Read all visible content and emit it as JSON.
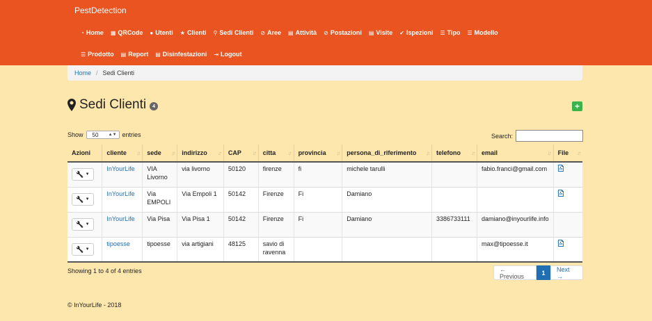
{
  "brand": "PestDetection",
  "nav": {
    "row1": [
      {
        "icon": "dashboard-icon",
        "glyph": "◔",
        "label": "Home"
      },
      {
        "icon": "qrcode-icon",
        "glyph": "▦",
        "label": "QRCode"
      },
      {
        "icon": "user-icon",
        "glyph": "●",
        "label": "Utenti"
      },
      {
        "icon": "star-icon",
        "glyph": "★",
        "label": "Clienti"
      },
      {
        "icon": "map-marker-icon",
        "glyph": "⚲",
        "label": "Sedi Clienti"
      },
      {
        "icon": "ban-icon",
        "glyph": "⊘",
        "label": "Aree"
      },
      {
        "icon": "calendar-icon",
        "glyph": "▤",
        "label": "Attività"
      },
      {
        "icon": "ban-icon",
        "glyph": "⊘",
        "label": "Postazioni"
      },
      {
        "icon": "calendar-icon",
        "glyph": "▤",
        "label": "Visite"
      },
      {
        "icon": "check-icon",
        "glyph": "✔",
        "label": "Ispezioni"
      },
      {
        "icon": "list-icon",
        "glyph": "☰",
        "label": "Tipo"
      },
      {
        "icon": "list-icon",
        "glyph": "☰",
        "label": "Modello"
      }
    ],
    "row2": [
      {
        "icon": "list-icon",
        "glyph": "☰",
        "label": "Prodotto"
      },
      {
        "icon": "calendar-icon",
        "glyph": "▤",
        "label": "Report"
      },
      {
        "icon": "calendar-icon",
        "glyph": "▤",
        "label": "Disinfestazioni"
      },
      {
        "icon": "logout-icon",
        "glyph": "⇥",
        "label": "Logout"
      }
    ]
  },
  "breadcrumb": {
    "home": "Home",
    "current": "Sedi Clienti"
  },
  "page": {
    "title": "Sedi Clienti",
    "count": "4",
    "add": "+"
  },
  "length": {
    "show": "Show",
    "value": "50",
    "entries": "entries"
  },
  "search": {
    "label": "Search:",
    "value": ""
  },
  "table": {
    "headers": [
      "Azioni",
      "cliente",
      "sede",
      "indirizzo",
      "CAP",
      "citta",
      "provincia",
      "persona_di_riferimento",
      "telefono",
      "email",
      "File"
    ],
    "rows": [
      {
        "cliente": "InYourLife",
        "sede": "VIA Livorno",
        "indirizzo": "via livorno",
        "cap": "50120",
        "citta": "firenze",
        "provincia": "fi",
        "persona": "michele tarulli",
        "telefono": "",
        "email": "fabio.franci@gmail.com",
        "file": true
      },
      {
        "cliente": "InYourLife",
        "sede": "Via EMPOLI",
        "indirizzo": "Via Empoli 1",
        "cap": "50142",
        "citta": "Firenze",
        "provincia": "Fi",
        "persona": "Damiano",
        "telefono": "",
        "email": "",
        "file": true
      },
      {
        "cliente": "InYourLife",
        "sede": "Via Pisa",
        "indirizzo": "Via Pisa 1",
        "cap": "50142",
        "citta": "Firenze",
        "provincia": "Fi",
        "persona": "Damiano",
        "telefono": "3386733111",
        "email": "damiano@inyourlife.info",
        "file": false
      },
      {
        "cliente": "tipoesse",
        "sede": "tipoesse",
        "indirizzo": "via artigiani",
        "cap": "48125",
        "citta": "savio di ravenna",
        "provincia": "",
        "persona": "",
        "telefono": "",
        "email": "max@tipoesse.it",
        "file": true
      }
    ]
  },
  "info": "Showing 1 to 4 of 4 entries",
  "pager": {
    "prev": "← Previous",
    "page": "1",
    "next": "Next →"
  },
  "footer": "© InYourLife - 2018",
  "colors": {
    "navbar": "#e95420",
    "background": "#fde7ad",
    "link": "#1f6fb2",
    "add": "#38b44a"
  }
}
